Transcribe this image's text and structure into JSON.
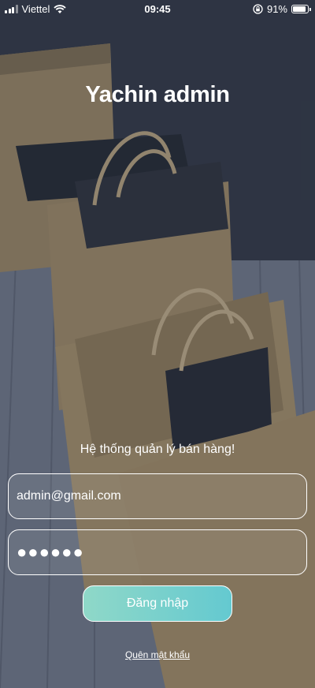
{
  "status_bar": {
    "carrier": "Viettel",
    "time": "09:45",
    "battery": "91%",
    "battery_level": 0.91,
    "icons": [
      "signal-icon",
      "wifi-icon",
      "orientation-lock-icon",
      "battery-icon"
    ]
  },
  "app": {
    "title": "Yachin admin",
    "subtitle": "Hệ thống quản lý bán hàng!"
  },
  "form": {
    "email_value": "admin@gmail.com",
    "password_value": "●●●●●●",
    "login_label": "Đăng nhập",
    "forgot_label": "Quên mật khẩu"
  },
  "colors": {
    "button_gradient_start": "#8fd8c8",
    "button_gradient_end": "#64c9d0",
    "overlay": "#2d374b"
  }
}
